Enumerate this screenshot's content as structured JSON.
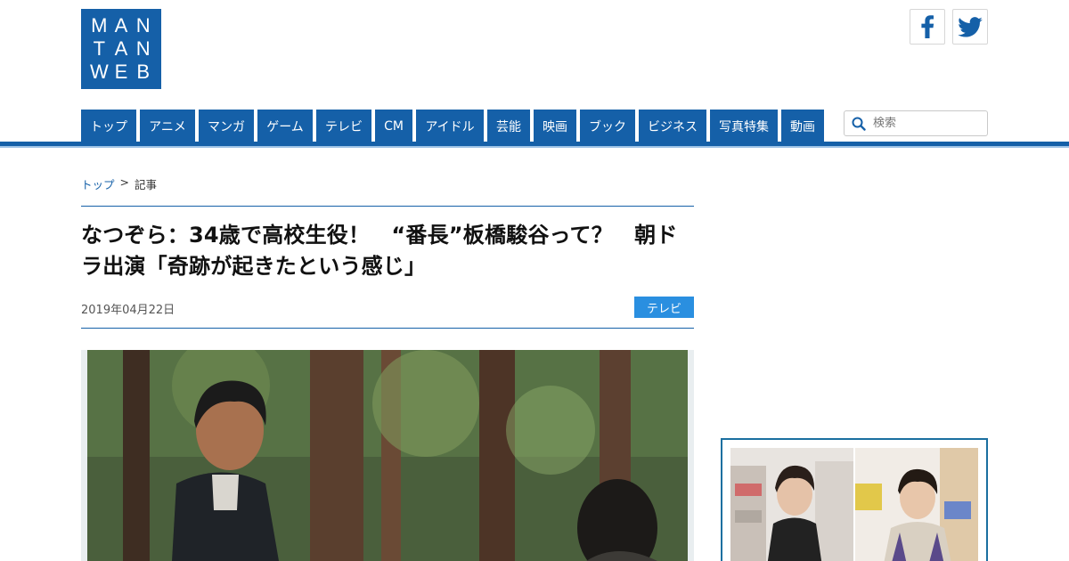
{
  "logo": {
    "rows": [
      "M",
      "A",
      "N",
      "T",
      "A",
      "N",
      "W",
      "E",
      "B"
    ],
    "color": "#1560a8"
  },
  "social": [
    {
      "name": "facebook",
      "icon": "facebook-icon"
    },
    {
      "name": "twitter",
      "icon": "twitter-icon"
    }
  ],
  "nav": {
    "items": [
      "トップ",
      "アニメ",
      "マンガ",
      "ゲーム",
      "テレビ",
      "CM",
      "アイドル",
      "芸能",
      "映画",
      "ブック",
      "ビジネス",
      "写真特集",
      "動画"
    ],
    "color": "#1560a8"
  },
  "search": {
    "placeholder": "検索",
    "value": ""
  },
  "breadcrumb": {
    "top": "トップ",
    "separator": ">",
    "current": "記事"
  },
  "article": {
    "title": "なつぞら：34歳で高校生役！　“番長”板橋駿谷って？　朝ドラ出演「奇跡が起きたという感じ」",
    "date": "2019年04月22日",
    "category": "テレビ"
  },
  "colors": {
    "accent": "#1560a8",
    "category_badge": "#2a8fe0",
    "side_border": "#1a6fa0"
  }
}
